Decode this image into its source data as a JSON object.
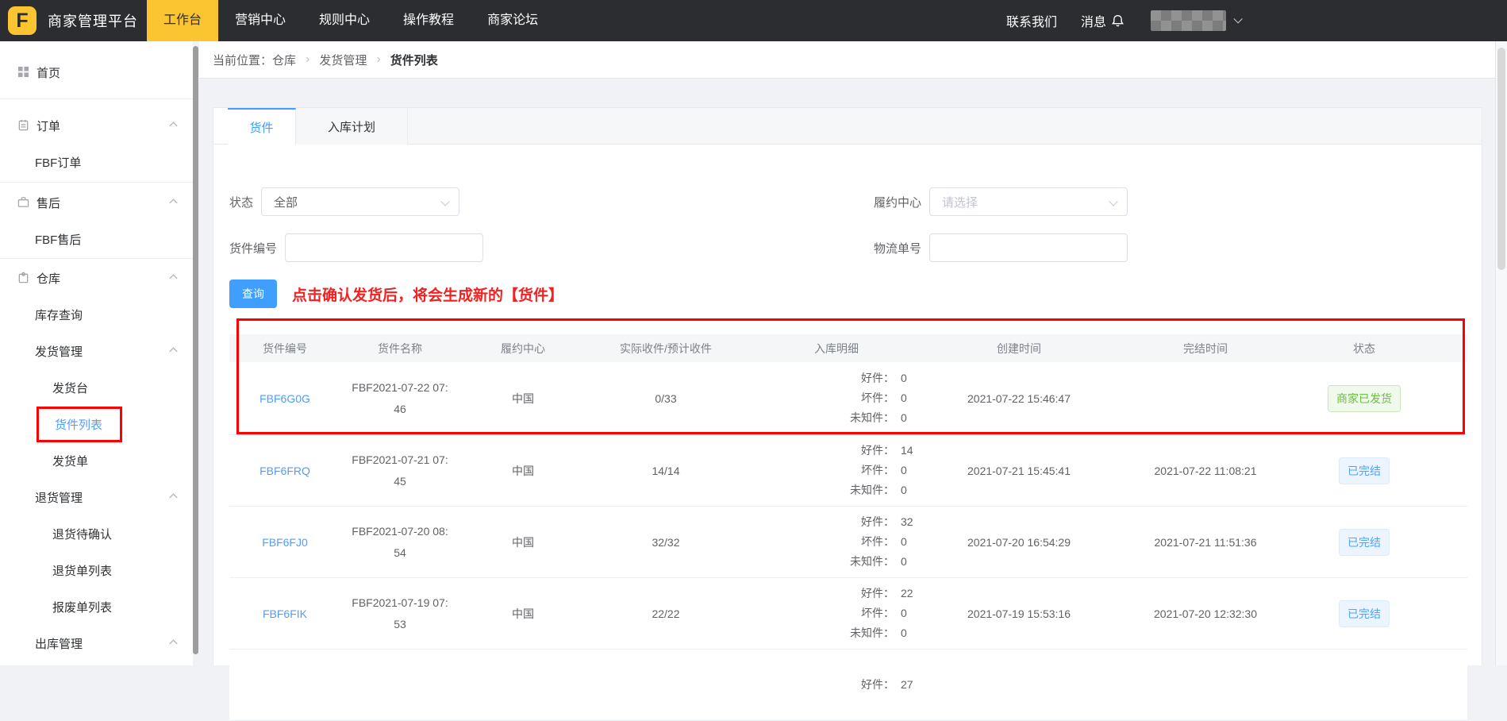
{
  "topbar": {
    "logo_letter": "F",
    "brand": "商家管理平台",
    "nav": [
      {
        "label": "工作台",
        "active": true
      },
      {
        "label": "营销中心",
        "active": false
      },
      {
        "label": "规则中心",
        "active": false
      },
      {
        "label": "操作教程",
        "active": false
      },
      {
        "label": "商家论坛",
        "active": false
      }
    ],
    "contact": "联系我们",
    "messages": "消息"
  },
  "sidebar": {
    "items": [
      {
        "label": "首页"
      },
      {
        "label": "订单"
      },
      {
        "label": "FBF订单"
      },
      {
        "label": "售后"
      },
      {
        "label": "FBF售后"
      },
      {
        "label": "仓库"
      },
      {
        "label": "库存查询"
      },
      {
        "label": "发货管理"
      },
      {
        "label": "发货台"
      },
      {
        "label": "货件列表"
      },
      {
        "label": "发货单"
      },
      {
        "label": "退货管理"
      },
      {
        "label": "退货待确认"
      },
      {
        "label": "退货单列表"
      },
      {
        "label": "报废单列表"
      },
      {
        "label": "出库管理"
      }
    ]
  },
  "breadcrumb": {
    "label": "当前位置：",
    "sep": "›",
    "items": [
      "仓库",
      "发货管理",
      "货件列表"
    ]
  },
  "tabs": [
    {
      "label": "货件",
      "active": true
    },
    {
      "label": "入库计划",
      "active": false
    }
  ],
  "filters": {
    "status": {
      "label": "状态",
      "value": "全部"
    },
    "center": {
      "label": "履约中心",
      "placeholder": "请选择"
    },
    "shipment": {
      "label": "货件编号",
      "value": ""
    },
    "tracking": {
      "label": "物流单号",
      "value": ""
    },
    "search": "查询"
  },
  "notice": "点击确认发货后，将会生成新的【货件】",
  "table": {
    "columns": [
      "货件编号",
      "货件名称",
      "履约中心",
      "实际收件/预计收件",
      "入库明细",
      "创建时间",
      "完结时间",
      "状态"
    ],
    "detail": {
      "good": "好件：",
      "bad": "坏件：",
      "unknown": "未知件："
    },
    "rows": [
      {
        "code": "FBF6G0G",
        "name": "FBF2021-07-22 07:46",
        "center": "中国",
        "received": "0/33",
        "good": "0",
        "bad": "0",
        "unknown": "0",
        "created": "2021-07-22 15:46:47",
        "finished": "",
        "status": "商家已发货"
      },
      {
        "code": "FBF6FRQ",
        "name": "FBF2021-07-21 07:45",
        "center": "中国",
        "received": "14/14",
        "good": "14",
        "bad": "0",
        "unknown": "0",
        "created": "2021-07-21 15:45:41",
        "finished": "2021-07-22 11:08:21",
        "status": "已完结"
      },
      {
        "code": "FBF6FJ0",
        "name": "FBF2021-07-20 08:54",
        "center": "中国",
        "received": "32/32",
        "good": "32",
        "bad": "0",
        "unknown": "0",
        "created": "2021-07-20 16:54:29",
        "finished": "2021-07-21 11:51:36",
        "status": "已完结"
      },
      {
        "code": "FBF6FIK",
        "name": "FBF2021-07-19 07:53",
        "center": "中国",
        "received": "22/22",
        "good": "22",
        "bad": "0",
        "unknown": "0",
        "created": "2021-07-19 15:53:16",
        "finished": "2021-07-20 12:32:30",
        "status": "已完结"
      },
      {
        "code": "",
        "name": "",
        "center": "",
        "received": "",
        "good": "27",
        "bad": "",
        "unknown": "",
        "created": "",
        "finished": "",
        "status": ""
      }
    ]
  },
  "colors": {
    "brand_yellow": "#fbc531",
    "accent_blue": "#409eff",
    "annotation_red": "#ff0000",
    "success_green": "#6abf40",
    "topbar_dark": "#2b2d30"
  }
}
